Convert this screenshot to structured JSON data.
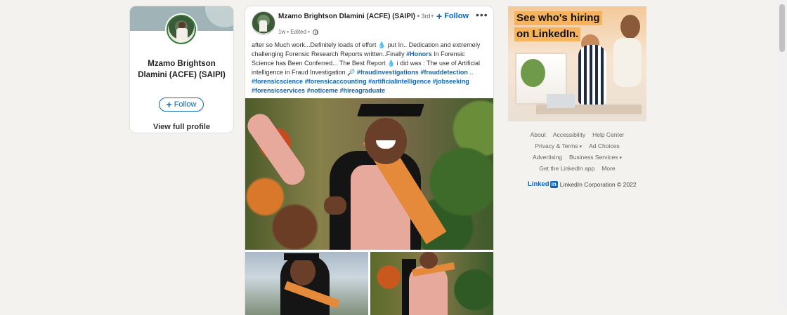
{
  "profile_card": {
    "name": "Mzamo Brightson Dlamini (ACFE) (SAIPI)",
    "follow_label": "Follow",
    "view_profile_label": "View full profile"
  },
  "post": {
    "author": "Mzamo Brightson Dlamini (ACFE) (SAIPI)",
    "degree": "• 3rd+",
    "time": "1w",
    "edited": "• Edited •",
    "follow_label": "Follow",
    "more_label": "•••",
    "text_parts": {
      "p1": "after so Much work...Definitely loads of effort 💧 put In.. Dedication and extremely challenging Forensic Research Reports written..Finally ",
      "tag1": "#Honors",
      "p2": " In Forensic Science has Been Conferred... The Best Report 💧 i did was : The use of Artificial intelligence in Fraud Investigation 🔎 ",
      "tag2": "#fraudinvestigations",
      "tag3": "#frauddetection",
      "p3": " .. ",
      "tag4": "#forensicscience",
      "tag5": "#forensicaccounting",
      "tag6": "#artificialintelligence",
      "tag7": "#jobseeking",
      "tag8": "#forensicservices",
      "tag9": "#noticeme",
      "tag10": "#hireagraduate"
    }
  },
  "ad": {
    "line1": "See who's hiring",
    "line2": "on LinkedIn."
  },
  "footer": {
    "about": "About",
    "accessibility": "Accessibility",
    "help_center": "Help Center",
    "privacy_terms": "Privacy & Terms",
    "ad_choices": "Ad Choices",
    "advertising": "Advertising",
    "business_services": "Business Services",
    "get_app": "Get the LinkedIn app",
    "more": "More",
    "brand_name": "Linked",
    "brand_in": "in",
    "copyright": "LinkedIn Corporation © 2022"
  },
  "icons": {
    "globe": "globe-icon",
    "chevron": "chevron-down-icon",
    "plus": "plus-icon"
  },
  "colors": {
    "accent": "#0a66c2",
    "background": "#f3f2ef",
    "ad_highlight": "#f6b35c"
  }
}
